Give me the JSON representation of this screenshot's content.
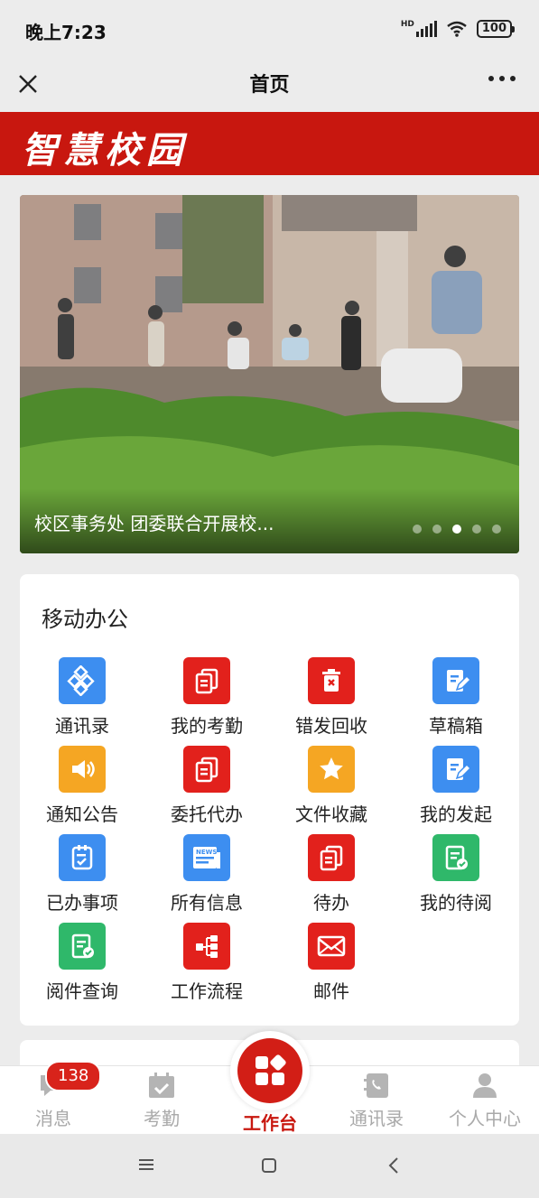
{
  "status_bar": {
    "time": "晚上7:23",
    "network": "HD",
    "battery": "100"
  },
  "header": {
    "title": "首页"
  },
  "banner": {
    "brand": "智慧校园"
  },
  "carousel": {
    "caption": "校区事务处 团委联合开展校...",
    "slide_count": 5,
    "active_slide": 3
  },
  "office": {
    "title": "移动办公",
    "apps": [
      {
        "label": "通讯录",
        "icon": "contacts-diamond-icon",
        "color": "#3d8ef0"
      },
      {
        "label": "我的考勤",
        "icon": "document-stack-icon",
        "color": "#e2211c"
      },
      {
        "label": "错发回收",
        "icon": "trash-bin-icon",
        "color": "#e2211c"
      },
      {
        "label": "草稿箱",
        "icon": "edit-document-icon",
        "color": "#3d8ef0"
      },
      {
        "label": "通知公告",
        "icon": "speaker-icon",
        "color": "#f5a623"
      },
      {
        "label": "委托代办",
        "icon": "document-stack-icon",
        "color": "#e2211c"
      },
      {
        "label": "文件收藏",
        "icon": "star-icon",
        "color": "#f5a623"
      },
      {
        "label": "我的发起",
        "icon": "edit-document-icon",
        "color": "#3d8ef0"
      },
      {
        "label": "已办事项",
        "icon": "checklist-icon",
        "color": "#3d8ef0"
      },
      {
        "label": "所有信息",
        "icon": "news-icon",
        "color": "#3d8ef0"
      },
      {
        "label": "待办",
        "icon": "document-stack-icon",
        "color": "#e2211c"
      },
      {
        "label": "我的待阅",
        "icon": "document-check-icon",
        "color": "#2fb86a"
      },
      {
        "label": "阅件查询",
        "icon": "document-check-icon",
        "color": "#2fb86a"
      },
      {
        "label": "工作流程",
        "icon": "workflow-icon",
        "color": "#e2211c"
      },
      {
        "label": "邮件",
        "icon": "mail-icon",
        "color": "#e2211c"
      }
    ]
  },
  "bottom_nav": {
    "messages": {
      "label": "消息",
      "badge": "138"
    },
    "attendance": {
      "label": "考勤"
    },
    "workbench": {
      "label": "工作台"
    },
    "contacts": {
      "label": "通讯录"
    },
    "profile": {
      "label": "个人中心"
    }
  }
}
